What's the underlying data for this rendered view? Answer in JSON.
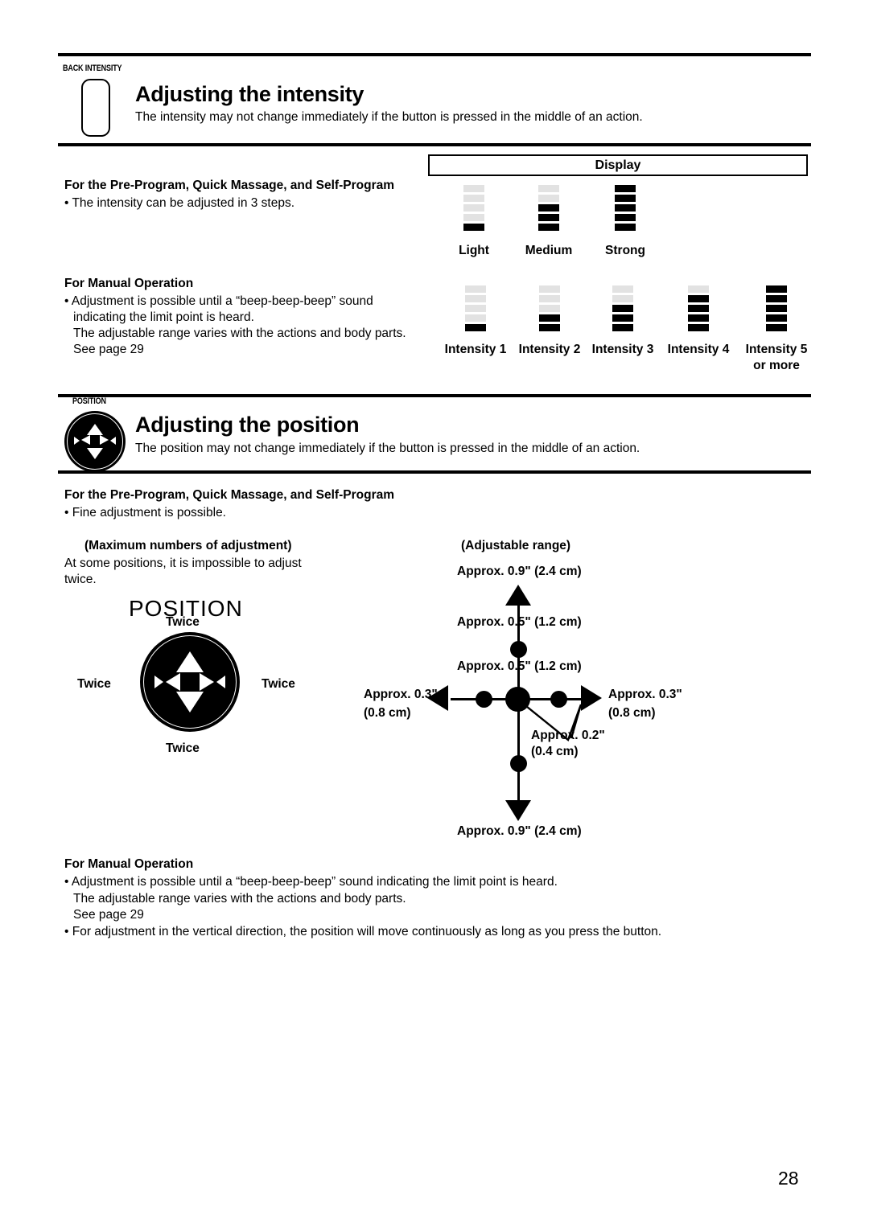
{
  "page": {
    "number": "28"
  },
  "intensity_section": {
    "tag": "BACK INTENSITY",
    "title": "Adjusting the intensity",
    "subtitle": "The intensity may not change immediately if the button is pressed in the middle of an action.",
    "button_icon": "back-intensity-button-icon",
    "display_box_label": "Display",
    "pre_program": {
      "heading": "For the Pre-Program, Quick Massage, and Self-Program",
      "bullet": "• The intensity can be adjusted in 3 steps."
    },
    "manual_operation": {
      "heading": "For Manual Operation",
      "lines": [
        "• Adjustment is possible until a “beep-beep-beep” sound",
        "indicating the limit point is heard.",
        "The adjustable range varies with the actions and body parts.",
        "See page 29"
      ]
    },
    "meters_program": [
      {
        "label": "Light",
        "total": 5,
        "filled": 1
      },
      {
        "label": "Medium",
        "total": 5,
        "filled": 3
      },
      {
        "label": "Strong",
        "total": 5,
        "filled": 5
      }
    ],
    "meters_manual": [
      {
        "label": "Intensity 1",
        "label2": "",
        "total": 5,
        "filled": 1
      },
      {
        "label": "Intensity 2",
        "label2": "",
        "total": 5,
        "filled": 2
      },
      {
        "label": "Intensity 3",
        "label2": "",
        "total": 5,
        "filled": 3
      },
      {
        "label": "Intensity 4",
        "label2": "",
        "total": 5,
        "filled": 4
      },
      {
        "label": "Intensity 5",
        "label2": "or more",
        "total": 5,
        "filled": 5
      }
    ]
  },
  "position_section": {
    "tag": "POSITION",
    "title": "Adjusting the position",
    "subtitle": "The position may not change immediately if the button is pressed in the middle of an action.",
    "button_icon": "position-dpad-button-icon",
    "pre_program": {
      "heading": "For the Pre-Program, Quick Massage, and Self-Program",
      "bullet": "• Fine adjustment is possible."
    },
    "max_adjustment": {
      "heading": "(Maximum numbers of adjustment)",
      "line1": "At some positions, it is impossible to adjust",
      "line2": "twice.",
      "dial_word": "POSITION",
      "label_top": "Twice",
      "label_left": "Twice",
      "label_right": "Twice",
      "label_bottom": "Twice"
    },
    "adjustable_range": {
      "heading": "(Adjustable range)",
      "top_outer": "Approx. 0.9\" (2.4 cm)",
      "top_inner": "Approx. 0.5\" (1.2 cm)",
      "mid_inner": "Approx. 0.5\" (1.2 cm)",
      "left_line1": "Approx. 0.3\"",
      "left_line2": "(0.8 cm)",
      "right_line1": "Approx. 0.3\"",
      "right_line2": "(0.8 cm)",
      "small_line1": "Approx. 0.2\"",
      "small_line2": "(0.4 cm)",
      "bottom_outer": "Approx. 0.9\" (2.4 cm)"
    },
    "manual_operation": {
      "heading": "For Manual Operation",
      "lines": [
        "• Adjustment is possible until a “beep-beep-beep” sound indicating the limit point is heard.",
        "The adjustable range varies with the actions and body parts.",
        "See page 29",
        "• For adjustment in the vertical direction, the position will move continuously as long as you press the button."
      ]
    }
  }
}
